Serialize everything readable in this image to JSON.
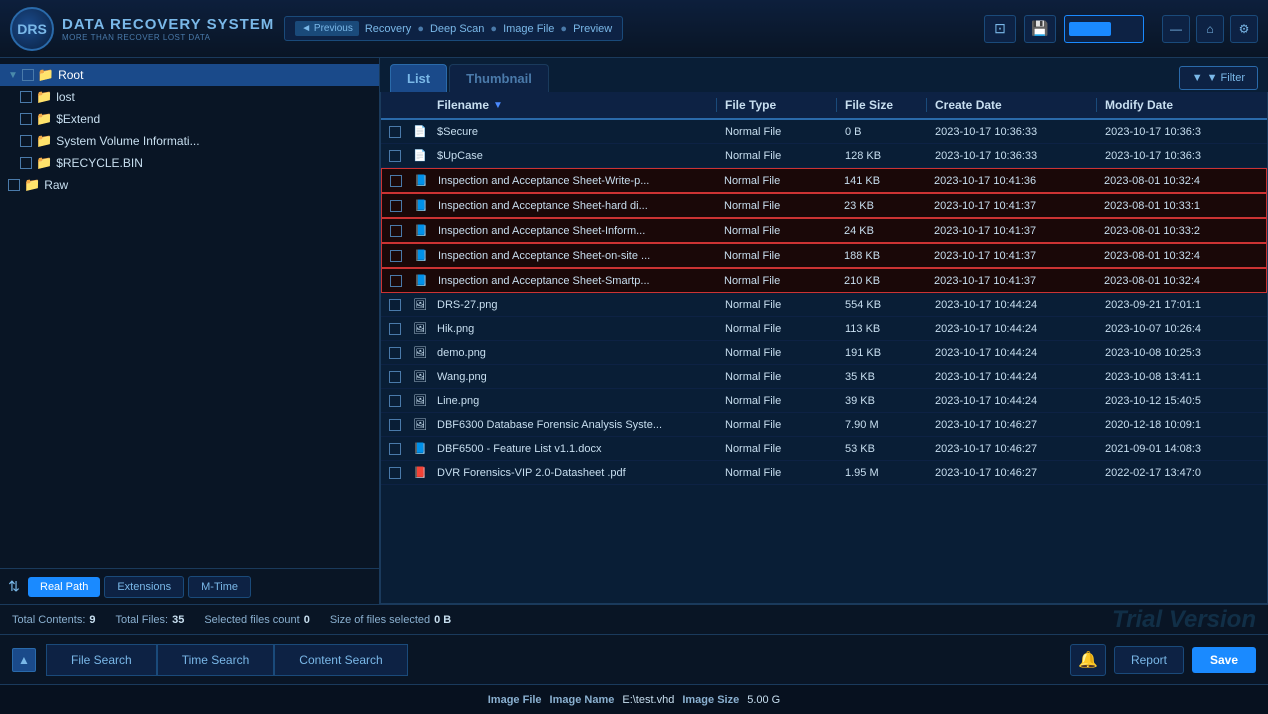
{
  "app": {
    "title": "DATA RECOVERY SYSTEM",
    "subtitle": "MORE THAN RECOVER LOST DATA",
    "logo_text": "DRS"
  },
  "breadcrumb": {
    "prev_label": "◄ Previous",
    "items": [
      "Recovery",
      "Deep Scan",
      "Image File",
      "Preview"
    ],
    "separators": [
      "●",
      "●",
      "●"
    ]
  },
  "toolbar": {
    "progress_label": "progress",
    "minimize_icon": "—",
    "home_icon": "⌂",
    "settings_icon": "⚙"
  },
  "sidebar": {
    "tree": [
      {
        "id": 1,
        "label": "Root",
        "type": "folder",
        "color": "blue",
        "indent": 0,
        "expanded": true,
        "selected": true,
        "has_checkbox": true
      },
      {
        "id": 2,
        "label": "lost",
        "type": "folder",
        "color": "yellow",
        "indent": 1,
        "has_checkbox": true
      },
      {
        "id": 3,
        "label": "$Extend",
        "type": "folder",
        "color": "yellow",
        "indent": 1,
        "has_checkbox": true
      },
      {
        "id": 4,
        "label": "System Volume Informati...",
        "type": "folder",
        "color": "gray",
        "indent": 1,
        "has_checkbox": true
      },
      {
        "id": 5,
        "label": "$RECYCLE.BIN",
        "type": "folder",
        "color": "gray",
        "indent": 1,
        "has_checkbox": true
      },
      {
        "id": 6,
        "label": "Raw",
        "type": "folder",
        "color": "gray",
        "indent": 0,
        "has_checkbox": true
      }
    ],
    "tabs": [
      {
        "id": "real-path",
        "label": "Real Path",
        "active": true
      },
      {
        "id": "extensions",
        "label": "Extensions",
        "active": false
      },
      {
        "id": "m-time",
        "label": "M-Time",
        "active": false
      }
    ]
  },
  "view_tabs": [
    {
      "id": "list",
      "label": "List",
      "active": true
    },
    {
      "id": "thumbnail",
      "label": "Thumbnail",
      "active": false
    }
  ],
  "filter_btn_label": "▼ Filter",
  "table": {
    "columns": [
      {
        "id": "check",
        "label": ""
      },
      {
        "id": "icon",
        "label": ""
      },
      {
        "id": "filename",
        "label": "Filename"
      },
      {
        "id": "filetype",
        "label": "File Type"
      },
      {
        "id": "filesize",
        "label": "File Size"
      },
      {
        "id": "createdate",
        "label": "Create Date"
      },
      {
        "id": "modifydate",
        "label": "Modify Date"
      }
    ],
    "rows": [
      {
        "id": 1,
        "filename": "$Secure",
        "filetype": "Normal File",
        "filesize": "0 B",
        "createdate": "2023-10-17 10:36:33",
        "modifydate": "2023-10-17 10:36:3",
        "icon": "📄",
        "highlighted": false
      },
      {
        "id": 2,
        "filename": "$UpCase",
        "filetype": "Normal File",
        "filesize": "128 KB",
        "createdate": "2023-10-17 10:36:33",
        "modifydate": "2023-10-17 10:36:3",
        "icon": "📄",
        "highlighted": false
      },
      {
        "id": 3,
        "filename": "Inspection and Acceptance Sheet-Write-p...",
        "filetype": "Normal File",
        "filesize": "141 KB",
        "createdate": "2023-10-17 10:41:36",
        "modifydate": "2023-08-01 10:32:4",
        "icon": "📘",
        "highlighted": true
      },
      {
        "id": 4,
        "filename": "Inspection and Acceptance Sheet-hard di...",
        "filetype": "Normal File",
        "filesize": "23 KB",
        "createdate": "2023-10-17 10:41:37",
        "modifydate": "2023-08-01 10:33:1",
        "icon": "📘",
        "highlighted": true
      },
      {
        "id": 5,
        "filename": "Inspection and Acceptance Sheet-Inform...",
        "filetype": "Normal File",
        "filesize": "24 KB",
        "createdate": "2023-10-17 10:41:37",
        "modifydate": "2023-08-01 10:33:2",
        "icon": "📘",
        "highlighted": true
      },
      {
        "id": 6,
        "filename": "Inspection and Acceptance Sheet-on-site ...",
        "filetype": "Normal File",
        "filesize": "188 KB",
        "createdate": "2023-10-17 10:41:37",
        "modifydate": "2023-08-01 10:32:4",
        "icon": "📘",
        "highlighted": true
      },
      {
        "id": 7,
        "filename": "Inspection and Acceptance Sheet-Smartp...",
        "filetype": "Normal File",
        "filesize": "210 KB",
        "createdate": "2023-10-17 10:41:37",
        "modifydate": "2023-08-01 10:32:4",
        "icon": "📘",
        "highlighted": true
      },
      {
        "id": 8,
        "filename": "DRS-27.png",
        "filetype": "Normal File",
        "filesize": "554 KB",
        "createdate": "2023-10-17 10:44:24",
        "modifydate": "2023-09-21 17:01:1",
        "icon": "🖼",
        "highlighted": false
      },
      {
        "id": 9,
        "filename": "Hik.png",
        "filetype": "Normal File",
        "filesize": "113 KB",
        "createdate": "2023-10-17 10:44:24",
        "modifydate": "2023-10-07 10:26:4",
        "icon": "🖼",
        "highlighted": false
      },
      {
        "id": 10,
        "filename": "demo.png",
        "filetype": "Normal File",
        "filesize": "191 KB",
        "createdate": "2023-10-17 10:44:24",
        "modifydate": "2023-10-08 10:25:3",
        "icon": "🖼",
        "highlighted": false
      },
      {
        "id": 11,
        "filename": "Wang.png",
        "filetype": "Normal File",
        "filesize": "35 KB",
        "createdate": "2023-10-17 10:44:24",
        "modifydate": "2023-10-08 13:41:1",
        "icon": "🖼",
        "highlighted": false
      },
      {
        "id": 12,
        "filename": "Line.png",
        "filetype": "Normal File",
        "filesize": "39 KB",
        "createdate": "2023-10-17 10:44:24",
        "modifydate": "2023-10-12 15:40:5",
        "icon": "🖼",
        "highlighted": false
      },
      {
        "id": 13,
        "filename": "DBF6300 Database Forensic Analysis Syste...",
        "filetype": "Normal File",
        "filesize": "7.90 M",
        "createdate": "2023-10-17 10:46:27",
        "modifydate": "2020-12-18 10:09:1",
        "icon": "🖼",
        "highlighted": false
      },
      {
        "id": 14,
        "filename": "DBF6500 - Feature List v1.1.docx",
        "filetype": "Normal File",
        "filesize": "53 KB",
        "createdate": "2023-10-17 10:46:27",
        "modifydate": "2021-09-01 14:08:3",
        "icon": "📘",
        "highlighted": false
      },
      {
        "id": 15,
        "filename": "DVR Forensics-VIP 2.0-Datasheet .pdf",
        "filetype": "Normal File",
        "filesize": "1.95 M",
        "createdate": "2023-10-17 10:46:27",
        "modifydate": "2022-02-17 13:47:0",
        "icon": "📕",
        "highlighted": false
      }
    ]
  },
  "status": {
    "total_contents_label": "Total Contents:",
    "total_contents_val": "9",
    "total_files_label": "Total Files:",
    "total_files_val": "35",
    "selected_files_label": "Selected files count",
    "selected_files_val": "0",
    "size_label": "Size of files  selected",
    "size_val": "0 B",
    "watermark": "Trial Version"
  },
  "bottom_search": {
    "collapse_icon": "▲",
    "tabs": [
      {
        "id": "file-search",
        "label": "File Search",
        "active": false
      },
      {
        "id": "time-search",
        "label": "Time Search",
        "active": false
      },
      {
        "id": "content-search",
        "label": "Content Search",
        "active": false
      }
    ],
    "bell_icon": "🔔",
    "report_label": "Report",
    "save_label": "Save"
  },
  "footer": {
    "image_file_label": "Image File",
    "image_name_label": "Image Name",
    "image_name_val": "E:\\test.vhd",
    "image_size_label": "Image Size",
    "image_size_val": "5.00 G"
  }
}
